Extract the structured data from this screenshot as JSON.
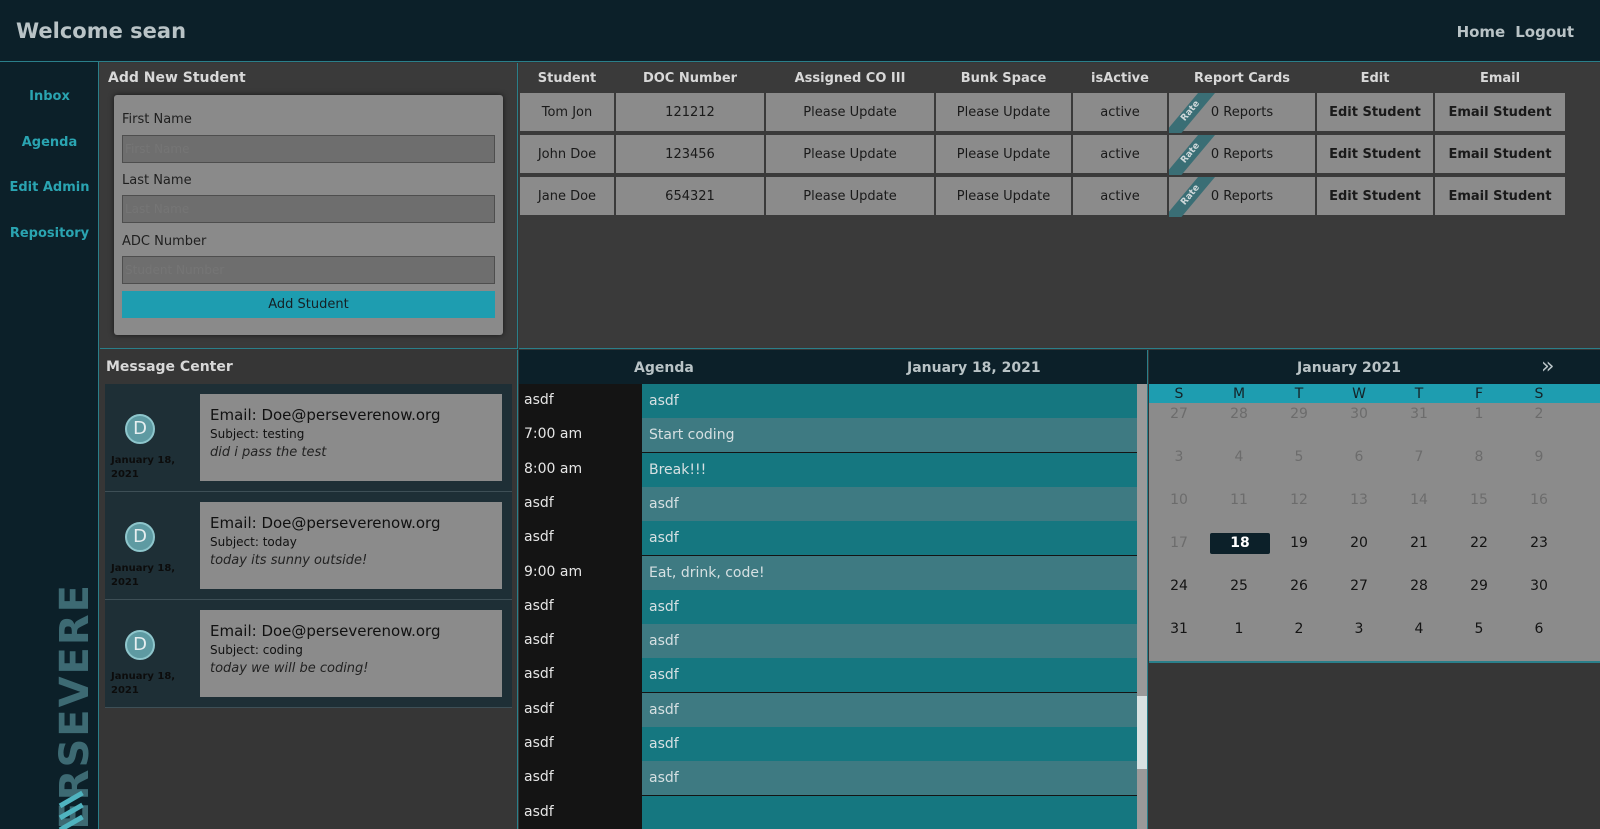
{
  "header": {
    "welcome": "Welcome sean",
    "nav": [
      "Home",
      "Logout"
    ]
  },
  "sidebar": {
    "items": [
      "Inbox",
      "Agenda",
      "Edit Admin",
      "Repository"
    ],
    "logo_text": "PERSEVERE"
  },
  "add_student": {
    "title": "Add New Student",
    "first_label": "First Name",
    "first_placeholder": "First Name",
    "last_label": "Last Name",
    "last_placeholder": "Last Name",
    "adc_label": "ADC Number",
    "adc_placeholder": "Student Number",
    "button": "Add Student"
  },
  "students": {
    "columns": [
      "Student",
      "DOC Number",
      "Assigned CO III",
      "Bunk Space",
      "isActive",
      "Report Cards",
      "Edit",
      "Email"
    ],
    "rate_label": "Rate",
    "rows": [
      {
        "name": "Tom Jon",
        "doc": "121212",
        "co": "Please Update",
        "bunk": "Please Update",
        "active": "active",
        "reports": "0 Reports",
        "edit": "Edit Student",
        "email": "Email Student"
      },
      {
        "name": "John Doe",
        "doc": "123456",
        "co": "Please Update",
        "bunk": "Please Update",
        "active": "active",
        "reports": "0 Reports",
        "edit": "Edit Student",
        "email": "Email Student"
      },
      {
        "name": "Jane Doe",
        "doc": "654321",
        "co": "Please Update",
        "bunk": "Please Update",
        "active": "active",
        "reports": "0 Reports",
        "edit": "Edit Student",
        "email": "Email Student"
      }
    ]
  },
  "messages": {
    "title": "Message Center",
    "items": [
      {
        "initial": "D",
        "date": "January 18, 2021",
        "email": "Email: Doe@perseverenow.org",
        "subject": "Subject: testing",
        "body": "did i pass the test"
      },
      {
        "initial": "D",
        "date": "January 18, 2021",
        "email": "Email: Doe@perseverenow.org",
        "subject": "Subject: today",
        "body": "today its sunny outside!"
      },
      {
        "initial": "D",
        "date": "January 18, 2021",
        "email": "Email: Doe@perseverenow.org",
        "subject": "Subject: coding",
        "body": "today we will be coding!"
      }
    ]
  },
  "agenda": {
    "title": "Agenda",
    "date": "January 18, 2021",
    "scroll_position": 0.84,
    "entries": [
      {
        "time": "asdf",
        "event": "asdf"
      },
      {
        "time": "7:00 am",
        "event": "Start coding"
      },
      {
        "time": "8:00 am",
        "event": "Break!!!"
      },
      {
        "time": "asdf",
        "event": "asdf"
      },
      {
        "time": "asdf",
        "event": "asdf"
      },
      {
        "time": "9:00 am",
        "event": "Eat, drink, code!"
      },
      {
        "time": "asdf",
        "event": "asdf"
      },
      {
        "time": "asdf",
        "event": "asdf"
      },
      {
        "time": "asdf",
        "event": "asdf"
      },
      {
        "time": "asdf",
        "event": "asdf"
      },
      {
        "time": "asdf",
        "event": "asdf"
      },
      {
        "time": "asdf",
        "event": "asdf"
      },
      {
        "time": "asdf",
        "event": ""
      }
    ]
  },
  "calendar": {
    "title": "January 2021",
    "next": "»",
    "dow": [
      "S",
      "M",
      "T",
      "W",
      "T",
      "F",
      "S"
    ],
    "weeks": [
      [
        "27",
        "28",
        "29",
        "30",
        "31",
        "1",
        "2"
      ],
      [
        "3",
        "4",
        "5",
        "6",
        "7",
        "8",
        "9"
      ],
      [
        "10",
        "11",
        "12",
        "13",
        "14",
        "15",
        "16"
      ],
      [
        "17",
        "18",
        "19",
        "20",
        "21",
        "22",
        "23"
      ],
      [
        "24",
        "25",
        "26",
        "27",
        "28",
        "29",
        "30"
      ],
      [
        "31",
        "1",
        "2",
        "3",
        "4",
        "5",
        "6"
      ]
    ],
    "selected_day": "18",
    "current_from": "18"
  },
  "colors": {
    "accent": "#1e9db0",
    "dark": "#0c2029",
    "link": "#2aa4b1"
  }
}
